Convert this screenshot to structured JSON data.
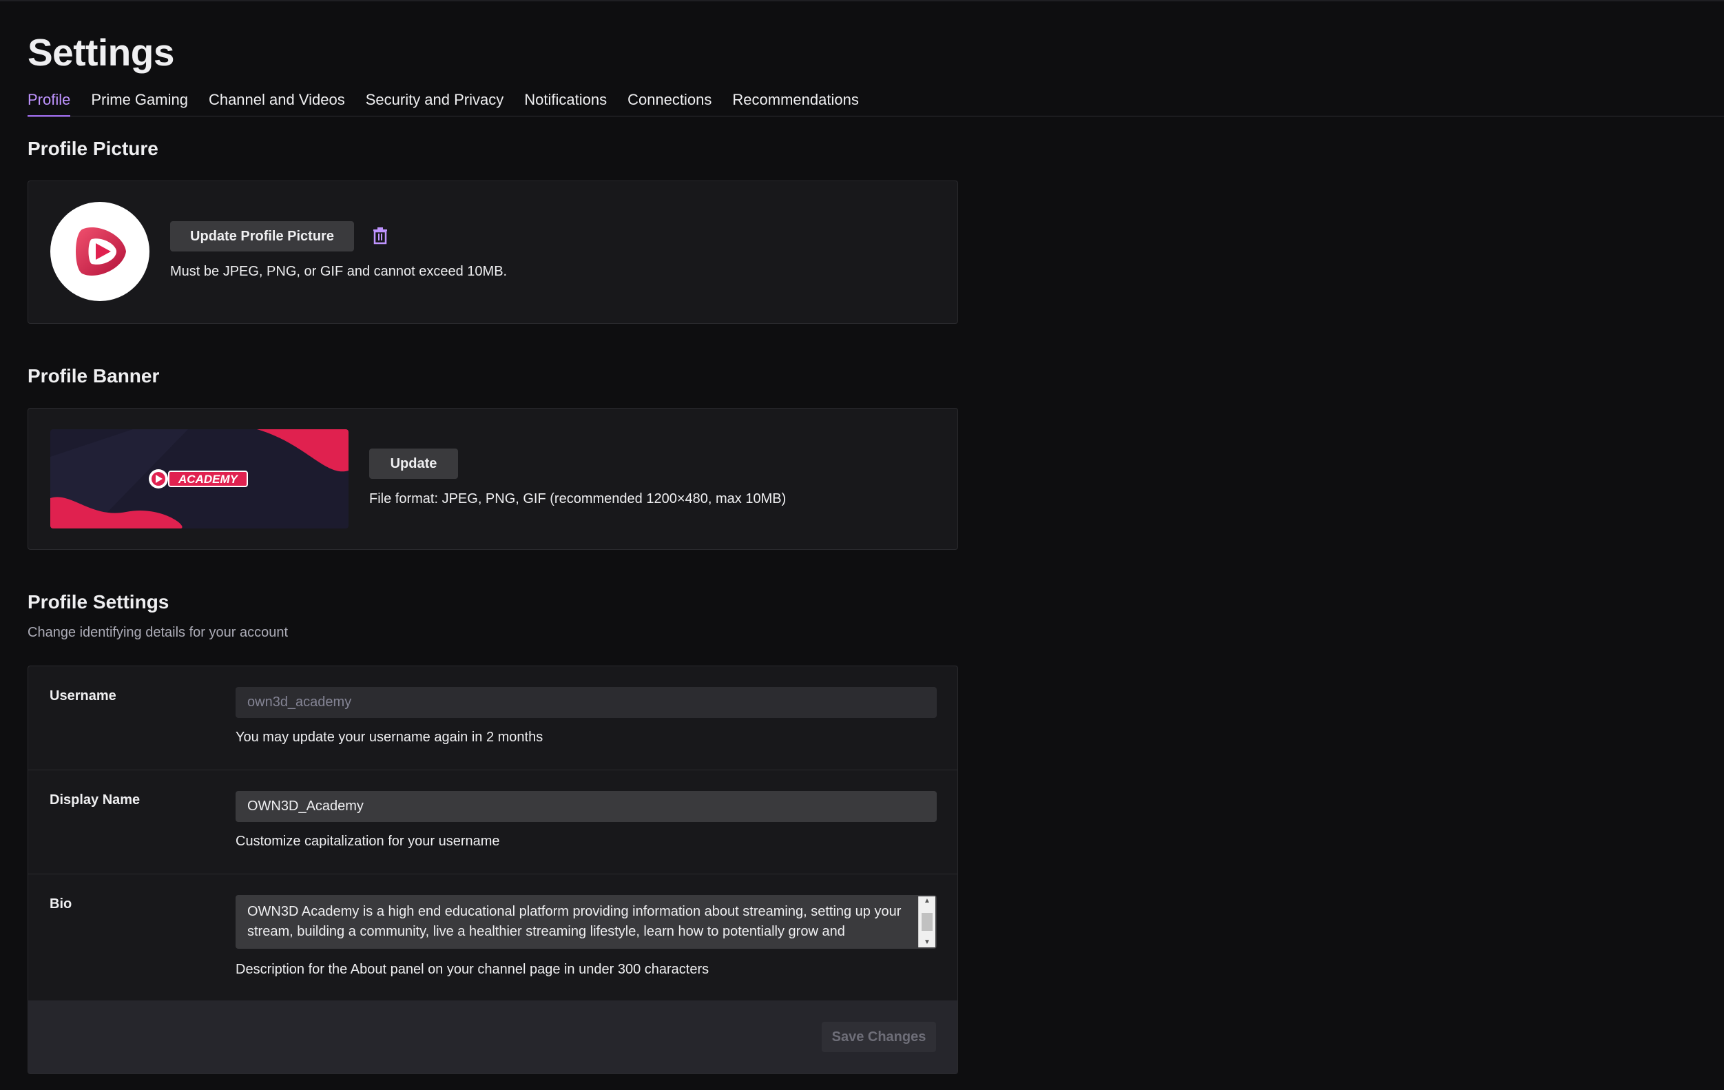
{
  "page": {
    "title": "Settings"
  },
  "tabs": [
    {
      "label": "Profile",
      "active": true
    },
    {
      "label": "Prime Gaming"
    },
    {
      "label": "Channel and Videos"
    },
    {
      "label": "Security and Privacy"
    },
    {
      "label": "Notifications"
    },
    {
      "label": "Connections"
    },
    {
      "label": "Recommendations"
    }
  ],
  "profile_picture": {
    "title": "Profile Picture",
    "update_label": "Update Profile Picture",
    "help": "Must be JPEG, PNG, or GIF and cannot exceed 10MB.",
    "delete_icon": "trash-icon"
  },
  "profile_banner": {
    "title": "Profile Banner",
    "update_label": "Update",
    "help": "File format: JPEG, PNG, GIF (recommended 1200×480, max 10MB)",
    "banner_text": "ACADEMY"
  },
  "profile_settings": {
    "title": "Profile Settings",
    "subtitle": "Change identifying details for your account",
    "username": {
      "label": "Username",
      "value": "own3d_academy",
      "help": "You may update your username again in 2 months"
    },
    "display_name": {
      "label": "Display Name",
      "value": "OWN3D_Academy",
      "help": "Customize capitalization for your username"
    },
    "bio": {
      "label": "Bio",
      "value": "OWN3D Academy is a high end educational platform providing information about streaming, setting up your stream, building a community, live a healthier streaming lifestyle, learn how to potentially grow and",
      "help": "Description for the About panel on your channel page in under 300 characters"
    },
    "save_label": "Save Changes"
  },
  "colors": {
    "accent": "#a970ff",
    "accent_text": "#bf94ff",
    "background": "#0e0e10",
    "card": "#18181b",
    "brand_red": "#e0214f"
  }
}
